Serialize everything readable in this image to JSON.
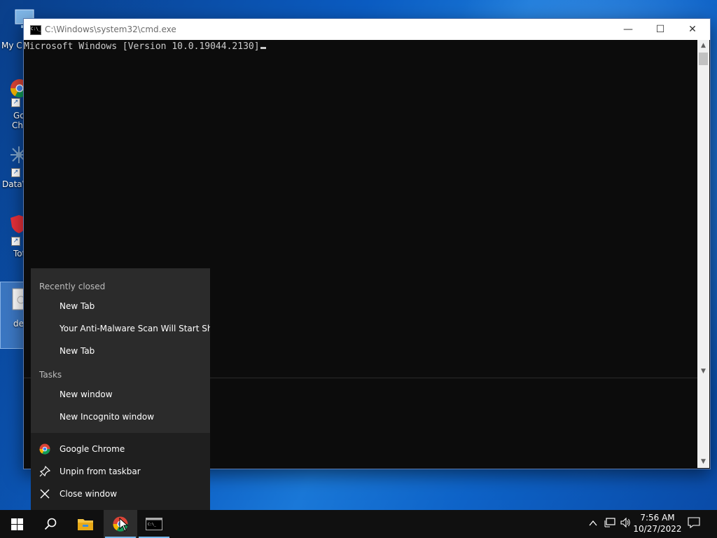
{
  "desktop": {
    "icons": [
      {
        "label": "My C",
        "icon": "computer-icon"
      },
      {
        "label": "Go",
        "label2": "Ch",
        "icon": "chrome-icon"
      },
      {
        "label": "DataW",
        "icon": "datawrapper-icon"
      },
      {
        "label": "Tot",
        "icon": "shield-icon"
      },
      {
        "label": "de",
        "icon": "document-icon"
      }
    ]
  },
  "cmd": {
    "title": "C:\\Windows\\system32\\cmd.exe",
    "line1": "Microsoft Windows [Version 10.0.19044.2130]",
    "minimize": "—",
    "maximize": "☐",
    "close": "✕"
  },
  "jumplist": {
    "recent_heading": "Recently closed",
    "recent": [
      "New Tab",
      "Your Anti-Malware Scan Will Start Shor...",
      "New Tab"
    ],
    "tasks_heading": "Tasks",
    "tasks": [
      "New window",
      "New Incognito window"
    ],
    "actions": [
      {
        "label": "Google Chrome",
        "icon": "chrome-icon"
      },
      {
        "label": "Unpin from taskbar",
        "icon": "unpin-icon"
      },
      {
        "label": "Close window",
        "icon": "close-icon"
      }
    ]
  },
  "taskbar": {
    "time": "7:56 AM",
    "date": "10/27/2022"
  },
  "colors": {
    "accent": "#76b9ed",
    "menu_bg": "#2b2b2b",
    "taskbar_bg": "#101010",
    "console_bg": "#0c0c0c"
  }
}
